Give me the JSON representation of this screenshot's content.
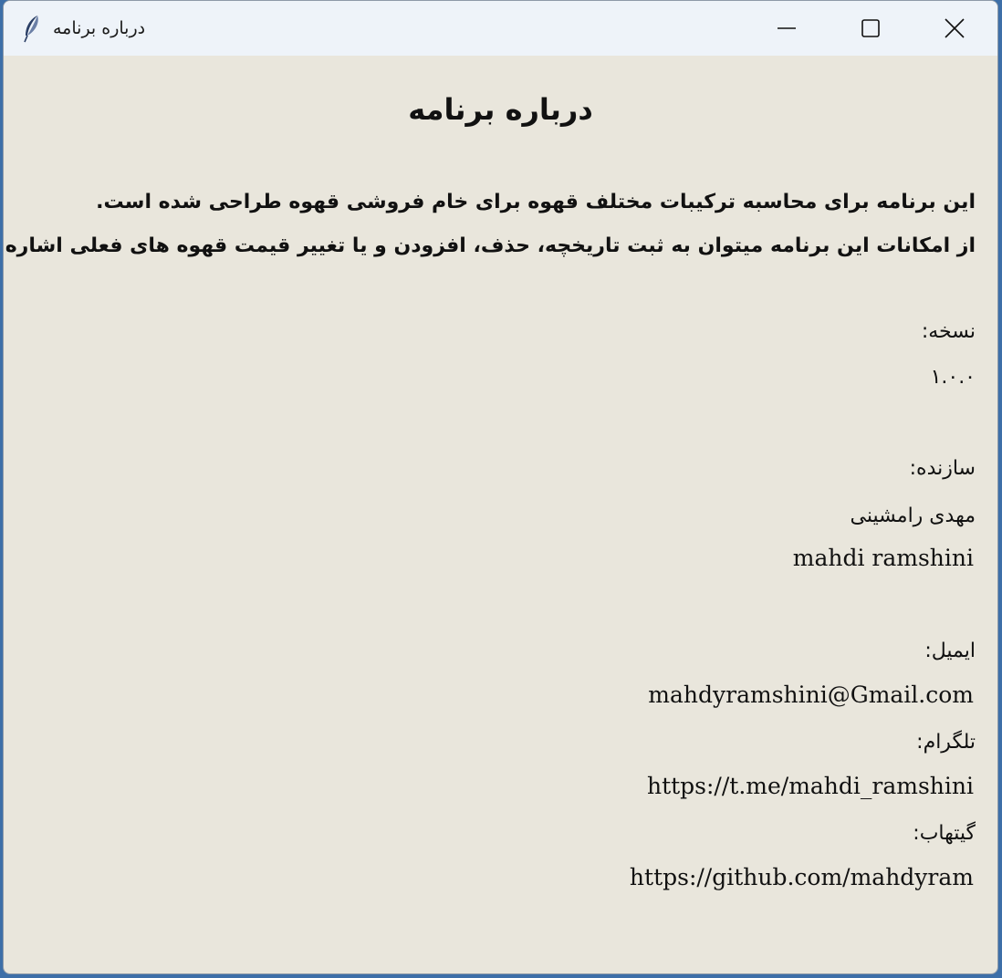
{
  "window": {
    "title": "درباره برنامه",
    "icon": "feather-icon",
    "controls": {
      "minimize": "minimize-icon",
      "maximize": "maximize-icon",
      "close": "close-icon"
    }
  },
  "about": {
    "heading": "درباره برنامه",
    "description_line1": "این برنامه برای محاسبه ترکیبات مختلف قهوه برای خام فروشی قهوه طراحی شده است.",
    "description_line2": "از امکانات این برنامه میتوان به ثبت تاریخچه، حذف، افزودن و یا تغییر قیمت قهوه های فعلی اشاره کرد.",
    "version_label": "نسخه:",
    "version_value": "۱.۰.۰",
    "author_label": "سازنده:",
    "author_name_fa": "مهدی رامشینی",
    "author_name_en": "mahdi ramshini",
    "email_label": "ایمیل:",
    "email_value": "mahdyramshini@Gmail.com",
    "telegram_label": "تلگرام:",
    "telegram_value": "https://t.me/mahdi_ramshini",
    "github_label": "گیتهاب:",
    "github_value": "https://github.com/mahdyram"
  },
  "colors": {
    "window_background": "#e9e6dc",
    "titlebar_background": "#eef3f9",
    "text": "#111111"
  }
}
